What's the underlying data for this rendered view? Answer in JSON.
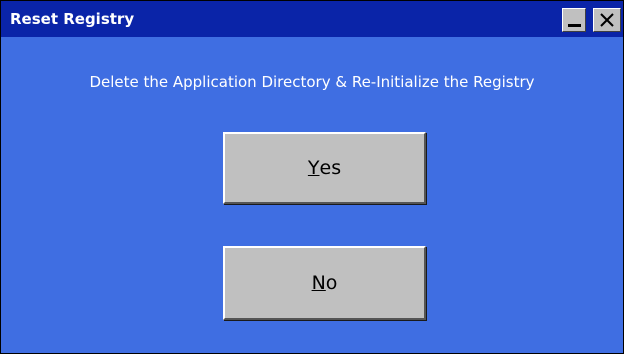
{
  "window": {
    "title": "Reset Registry",
    "minimize_icon": "minimize-icon",
    "close_icon": "close-icon"
  },
  "dialog": {
    "message": "Delete the Application Directory & Re-Initialize the Registry",
    "yes_button": {
      "mnemonic": "Y",
      "rest": "es"
    },
    "no_button": {
      "mnemonic": "N",
      "rest": "o"
    }
  },
  "colors": {
    "titlebar": "#0a24a8",
    "background": "#3f6ee2",
    "button_face": "#c0c0c0"
  }
}
